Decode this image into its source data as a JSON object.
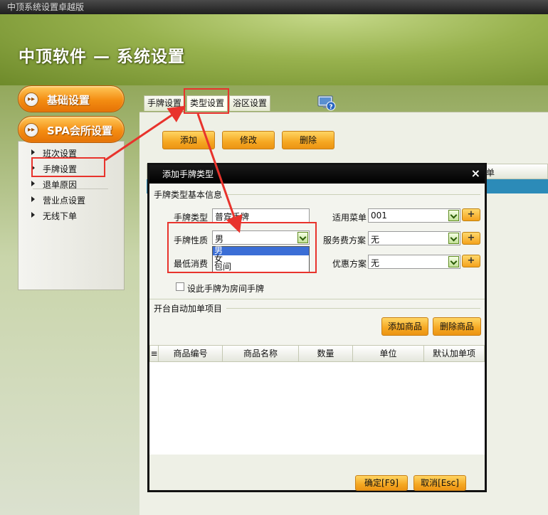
{
  "window": {
    "title": "中顶系统设置卓越版"
  },
  "header": {
    "title": "中顶软件 — 系统设置"
  },
  "sidebar": {
    "buttons": [
      {
        "label": "基础设置"
      },
      {
        "label": "SPA会所设置"
      }
    ],
    "items": [
      {
        "label": "班次设置"
      },
      {
        "label": "手牌设置"
      },
      {
        "label": "退单原因"
      },
      {
        "label": "营业点设置"
      },
      {
        "label": "无线下单"
      }
    ]
  },
  "tabs": [
    {
      "label": "手牌设置"
    },
    {
      "label": "类型设置"
    },
    {
      "label": "浴区设置"
    }
  ],
  "toolbar": {
    "add": "添加",
    "edit": "修改",
    "delete": "删除"
  },
  "main_grid": {
    "partial_header": "单"
  },
  "dialog": {
    "title": "添加手牌类型",
    "close": "×",
    "basic_section": "手牌类型基本信息",
    "fields": {
      "type_label": "手牌类型",
      "type_value": "普宾手牌",
      "nature_label": "手牌性质",
      "nature_value": "男",
      "nature_options": [
        "男",
        "女",
        "包间"
      ],
      "min_label": "最低消费",
      "menu_label": "适用菜单",
      "menu_value": "001",
      "service_label": "服务费方案",
      "service_value": "无",
      "discount_label": "优惠方案",
      "discount_value": "无",
      "plus": "+"
    },
    "room_checkbox_label": "设此手牌为房间手牌",
    "auto_section": "开台自动加单项目",
    "add_goods": "添加商品",
    "delete_goods": "删除商品",
    "grid_columns": [
      "≡",
      "商品编号",
      "商品名称",
      "数量",
      "单位",
      "默认加单项"
    ],
    "ok": "确定[F9]",
    "cancel": "取消[Esc]"
  },
  "colors": {
    "accent_orange": "#f48d12",
    "header_green": "#98b24e",
    "selection_blue": "#3b6ed6",
    "annotation_red": "#e8332c"
  }
}
